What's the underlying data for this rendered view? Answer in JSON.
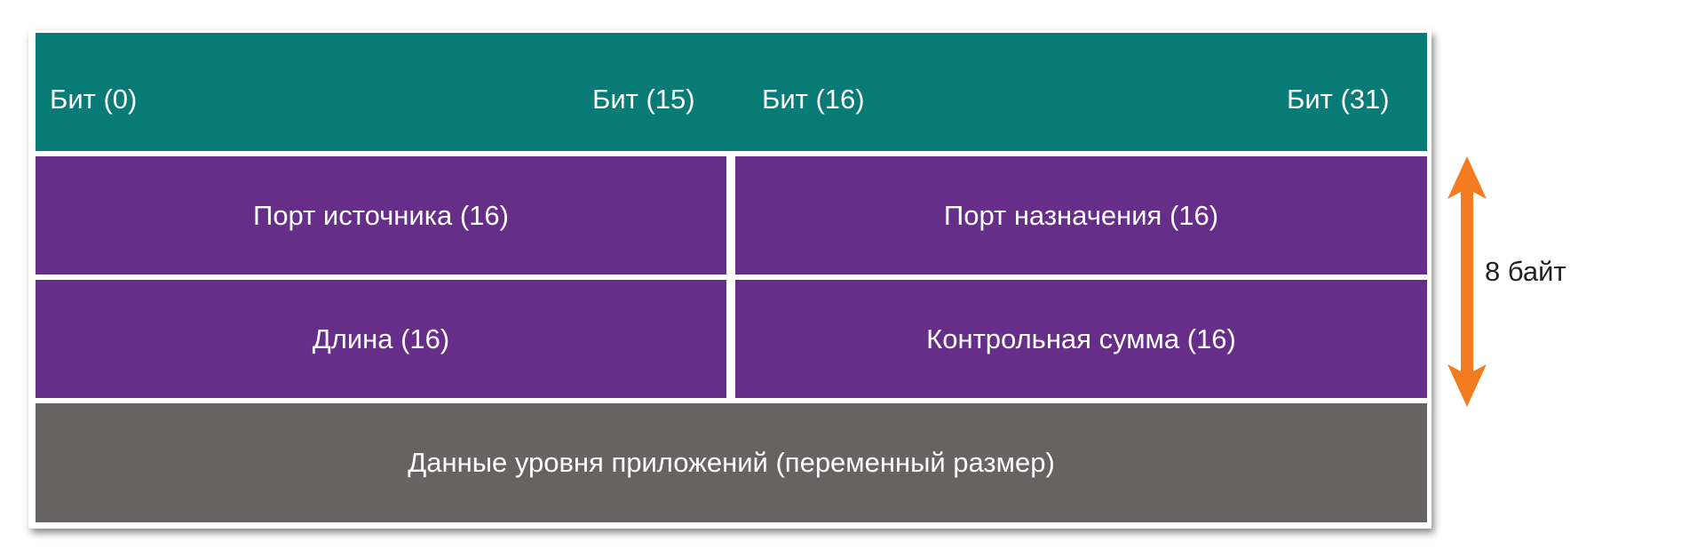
{
  "header": {
    "bit_0": "Бит (0)",
    "bit_15": "Бит (15)",
    "bit_16": "Бит (16)",
    "bit_31": "Бит (31)"
  },
  "fields": {
    "source_port": "Порт источника (16)",
    "destination_port": "Порт назначения (16)",
    "length": "Длина (16)",
    "checksum": "Контрольная сумма (16)",
    "app_data": "Данные уровня приложений (переменный размер)"
  },
  "size_label": "8 байт",
  "colors": {
    "header": "#087b77",
    "field": "#662d89",
    "data": "#676363",
    "arrow": "#f47c20"
  }
}
